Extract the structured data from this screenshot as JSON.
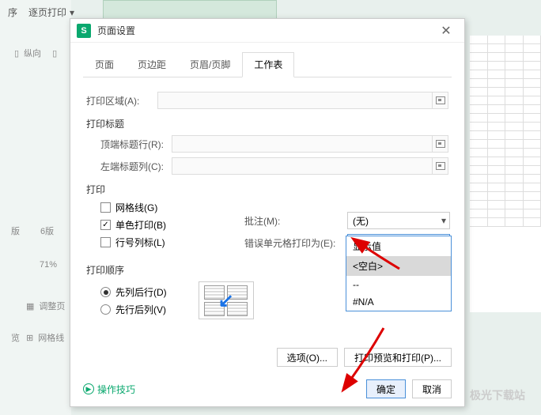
{
  "bg": {
    "dropdown_label": "逐页打印",
    "vertical_label": "纵向",
    "side_items": [
      "版",
      "6版"
    ],
    "zoom": "71%",
    "adjust_label": "调整页",
    "gridlines_label": "网格线",
    "preview_label": "览"
  },
  "dialog": {
    "title": "页面设置",
    "tabs": [
      "页面",
      "页边距",
      "页眉/页脚",
      "工作表"
    ],
    "print_area_label": "打印区域(A):",
    "print_titles_label": "打印标题",
    "top_title_row_label": "顶端标题行(R):",
    "left_title_col_label": "左端标题列(C):",
    "print_label": "打印",
    "gridlines_label": "网格线(G)",
    "monochrome_label": "单色打印(B)",
    "rowcol_headings_label": "行号列标(L)",
    "comments_label": "批注(M):",
    "comments_value": "(无)",
    "errors_label": "错误单元格打印为(E):",
    "errors_value": "显示值",
    "errors_options": [
      "显示值",
      "<空白>",
      "--",
      "#N/A"
    ],
    "print_order_label": "打印顺序",
    "order_down_then_over": "先列后行(D)",
    "order_over_then_down": "先行后列(V)",
    "options_btn": "选项(O)...",
    "preview_print_btn": "打印预览和打印(P)...",
    "help_link": "操作技巧",
    "ok_btn": "确定",
    "cancel_btn": "取消"
  },
  "watermark": "极光下载站"
}
